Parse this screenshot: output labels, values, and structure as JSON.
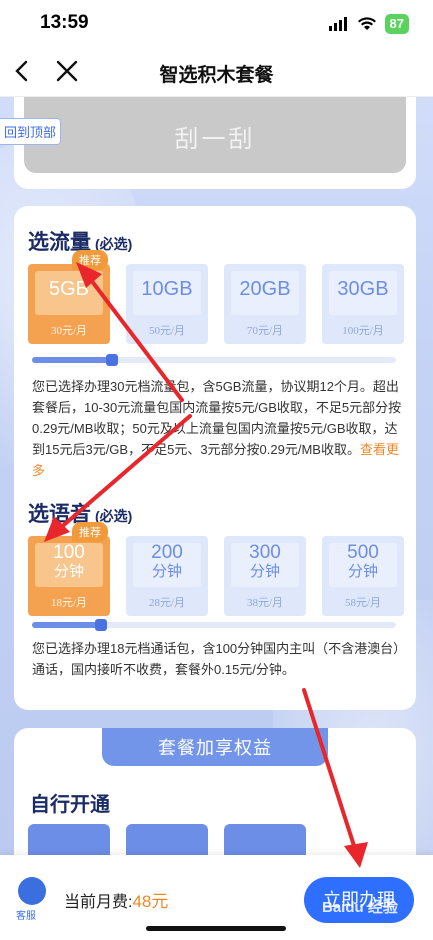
{
  "status_bar": {
    "time": "13:59",
    "battery": "87"
  },
  "nav": {
    "title": "智选积木套餐"
  },
  "scratch": {
    "label": "刮一刮"
  },
  "back_to_top": "回到顶部",
  "traffic": {
    "title": "选流量",
    "required": "(必选)",
    "options": [
      {
        "amount": "5GB",
        "price": "30元/月",
        "badge": "推荐",
        "selected": true
      },
      {
        "amount": "10GB",
        "price": "50元/月"
      },
      {
        "amount": "20GB",
        "price": "70元/月"
      },
      {
        "amount": "30GB",
        "price": "100元/月"
      }
    ],
    "slider_value_pct": 22,
    "desc": "您已选择办理30元档流量包，含5GB流量，协议期12个月。超出套餐后，10-30元流量包国内流量按5元/GB收取，不足5元部分按0.29元/MB收取；50元及以上流量包国内流量按5元/GB收取，达到15元后3元/GB，不足5元、3元部分按0.29元/MB收取。",
    "more": "查看更多"
  },
  "voice": {
    "title": "选语音",
    "required": "(必选)",
    "options": [
      {
        "amount": "100",
        "unit": "分钟",
        "price": "18元/月",
        "badge": "推荐",
        "selected": true
      },
      {
        "amount": "200",
        "unit": "分钟",
        "price": "28元/月"
      },
      {
        "amount": "300",
        "unit": "分钟",
        "price": "38元/月"
      },
      {
        "amount": "500",
        "unit": "分钟",
        "price": "58元/月"
      }
    ],
    "slider_value_pct": 19,
    "desc": "您已选择办理18元档通话包，含100分钟国内主叫（不含港澳台）通话，国内接听不收费，套餐外0.15元/分钟。"
  },
  "benefits": {
    "header": "套餐加享权益",
    "subtitle": "自行开通"
  },
  "bottom": {
    "cs_label": "客服",
    "fee_label": "当前月费:",
    "fee_value": "48元",
    "apply_label": "立即办理"
  },
  "watermark": "Baidu 经验",
  "colors": {
    "accent": "#6d8ee6",
    "selected": "#f4a24f",
    "cta": "#2f6fff",
    "arrow": "#e8262b"
  }
}
